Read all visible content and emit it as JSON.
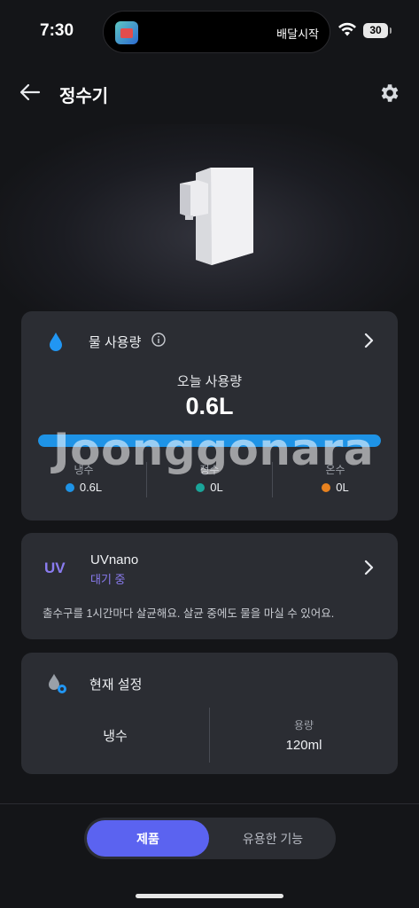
{
  "status_bar": {
    "time": "7:30",
    "activity_text": "배달시작",
    "battery": "30"
  },
  "header": {
    "title": "정수기"
  },
  "water_usage": {
    "title": "물 사용량",
    "today_label": "오늘 사용량",
    "today_value": "0.6L",
    "bar_fill_fraction": 1.0,
    "stats": [
      {
        "label": "냉수",
        "value": "0.6L",
        "color": "#1e93e6"
      },
      {
        "label": "정수",
        "value": "0L",
        "color": "#1aa59a"
      },
      {
        "label": "온수",
        "value": "0L",
        "color": "#e8821f"
      }
    ]
  },
  "watermark": "Joonggonara",
  "uv": {
    "badge": "UV",
    "title": "UVnano",
    "status": "대기 중",
    "description": "출수구를 1시간마다 살균해요. 살균 중에도 물을 마실 수 있어요.",
    "accent": "#8a7cf0"
  },
  "settings": {
    "title": "현재 설정",
    "mode": "냉수",
    "capacity_label": "용량",
    "capacity_value": "120ml"
  },
  "bottom_tabs": {
    "active": "제품",
    "items": [
      "제품",
      "유용한 기능"
    ]
  },
  "colors": {
    "accent": "#5b63f0",
    "background": "#141518",
    "card": "#2b2d33"
  }
}
